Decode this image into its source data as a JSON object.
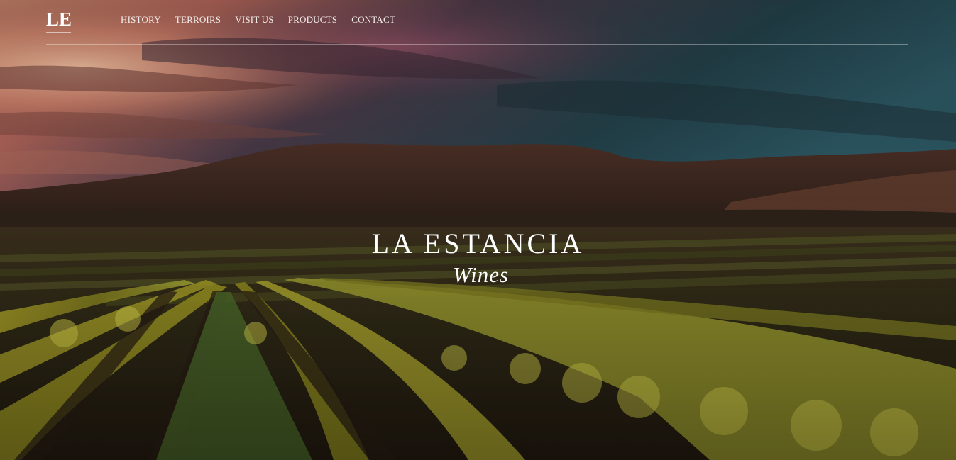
{
  "header": {
    "logo": "LE",
    "nav": [
      {
        "label": "HISTORY"
      },
      {
        "label": "TERROIRS"
      },
      {
        "label": "VISIT US"
      },
      {
        "label": "PRODUCTS"
      },
      {
        "label": "CONTACT"
      }
    ]
  },
  "hero": {
    "title": "LA ESTANCIA",
    "subtitle": "Wines"
  },
  "colors": {
    "text": "#ffffff",
    "header_rule": "#8a8a8a",
    "sky_warm": "#e9a27c",
    "sky_cool": "#2b5a66",
    "hills": "#4a2f24",
    "vines": "#c9c23a"
  }
}
